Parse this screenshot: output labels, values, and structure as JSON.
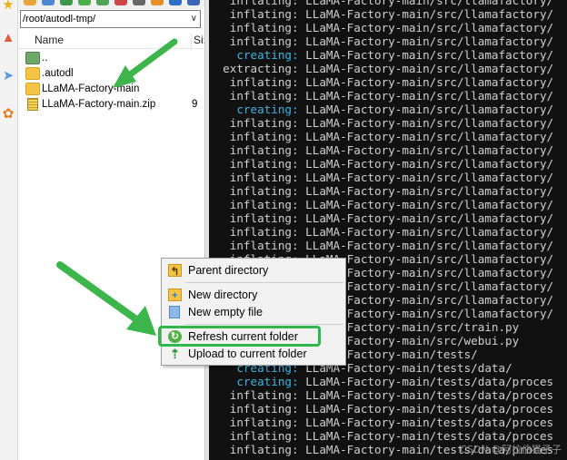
{
  "browser": {
    "path": "/root/autodl-tmp/",
    "columns": {
      "name": "Name",
      "size": "Si:"
    },
    "files": [
      {
        "name": "..",
        "size": "",
        "type": "up"
      },
      {
        "name": ".autodl",
        "size": "",
        "type": "folder"
      },
      {
        "name": "LLaMA-Factory-main",
        "size": "",
        "type": "folder"
      },
      {
        "name": "LLaMA-Factory-main.zip",
        "size": "9",
        "type": "zip"
      }
    ]
  },
  "context_menu": {
    "items": [
      {
        "label": "Parent directory",
        "icon": "parent-directory-icon"
      },
      {
        "label": "New directory",
        "icon": "new-folder-icon"
      },
      {
        "label": "New empty file",
        "icon": "new-file-icon"
      },
      {
        "label": "Refresh current folder",
        "icon": "refresh-icon"
      },
      {
        "label": "Upload to current folder",
        "icon": "upload-icon"
      }
    ]
  },
  "terminal": {
    "lines": [
      {
        "verb": "inflating:",
        "path": "LLaMA-Factory-main/src/llamafactory/"
      },
      {
        "verb": "inflating:",
        "path": "LLaMA-Factory-main/src/llamafactory/"
      },
      {
        "verb": "inflating:",
        "path": "LLaMA-Factory-main/src/llamafactory/"
      },
      {
        "verb": "inflating:",
        "path": "LLaMA-Factory-main/src/llamafactory/"
      },
      {
        "verb": "creating:",
        "path": "LLaMA-Factory-main/src/llamafactory/"
      },
      {
        "verb": "extracting:",
        "path": "LLaMA-Factory-main/src/llamafactory/"
      },
      {
        "verb": "inflating:",
        "path": "LLaMA-Factory-main/src/llamafactory/"
      },
      {
        "verb": "inflating:",
        "path": "LLaMA-Factory-main/src/llamafactory/"
      },
      {
        "verb": "creating:",
        "path": "LLaMA-Factory-main/src/llamafactory/"
      },
      {
        "verb": "inflating:",
        "path": "LLaMA-Factory-main/src/llamafactory/"
      },
      {
        "verb": "inflating:",
        "path": "LLaMA-Factory-main/src/llamafactory/"
      },
      {
        "verb": "inflating:",
        "path": "LLaMA-Factory-main/src/llamafactory/"
      },
      {
        "verb": "inflating:",
        "path": "LLaMA-Factory-main/src/llamafactory/"
      },
      {
        "verb": "inflating:",
        "path": "LLaMA-Factory-main/src/llamafactory/"
      },
      {
        "verb": "inflating:",
        "path": "LLaMA-Factory-main/src/llamafactory/"
      },
      {
        "verb": "inflating:",
        "path": "LLaMA-Factory-main/src/llamafactory/"
      },
      {
        "verb": "inflating:",
        "path": "LLaMA-Factory-main/src/llamafactory/"
      },
      {
        "verb": "inflating:",
        "path": "LLaMA-Factory-main/src/llamafactory/"
      },
      {
        "verb": "inflating:",
        "path": "LLaMA-Factory-main/src/llamafactory/"
      },
      {
        "verb": "inflating:",
        "path": "LLaMA-Factory-main/src/llamafactory/"
      },
      {
        "verb": "inflating:",
        "path": "LLaMA-Factory-main/src/llamafactory/"
      },
      {
        "verb": "inflating:",
        "path": "LLaMA-Factory-main/src/llamafactory/"
      },
      {
        "verb": "inflating:",
        "path": "LLaMA-Factory-main/src/llamafactory/"
      },
      {
        "verb": "inflating:",
        "path": "LLaMA-Factory-main/src/llamafactory/"
      },
      {
        "verb": "inflating:",
        "path": "LLaMA-Factory-main/src/train.py"
      },
      {
        "verb": "inflating:",
        "path": "LLaMA-Factory-main/src/webui.py"
      },
      {
        "verb": "creating:",
        "path": "LLaMA-Factory-main/tests/"
      },
      {
        "verb": "creating:",
        "path": "LLaMA-Factory-main/tests/data/"
      },
      {
        "verb": "creating:",
        "path": "LLaMA-Factory-main/tests/data/proces"
      },
      {
        "verb": "inflating:",
        "path": "LLaMA-Factory-main/tests/data/proces"
      },
      {
        "verb": "inflating:",
        "path": "LLaMA-Factory-main/tests/data/proces"
      },
      {
        "verb": "inflating:",
        "path": "LLaMA-Factory-main/tests/data/proces"
      },
      {
        "verb": "inflating:",
        "path": "LLaMA-Factory-main/tests/data/proces"
      },
      {
        "verb": "inflating:",
        "path": "LLaMA-Factory-main/tests/data/proces"
      }
    ]
  },
  "watermark": "CSDN @阿拉伯猫子子",
  "colors": {
    "highlight": "#2db84a",
    "arrow": "#3cb54a",
    "creating": "#3fb4e0"
  }
}
